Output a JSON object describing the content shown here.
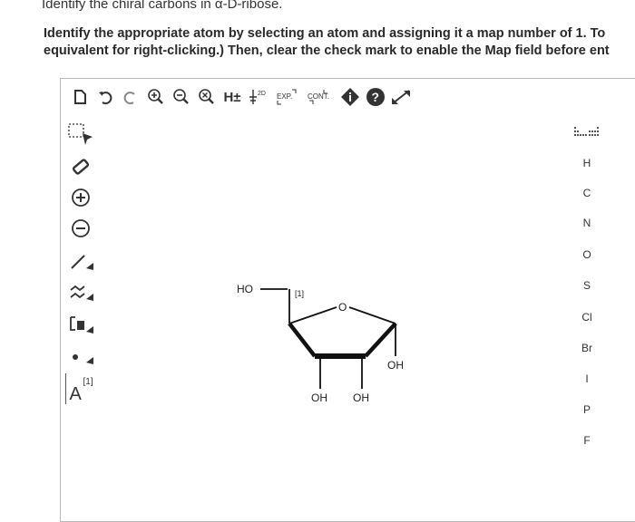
{
  "question": {
    "title": "Identify the chiral carbons in α-D-ribose.",
    "line1": "Identify the appropriate atom by selecting an atom and assigning it a map number of 1. To",
    "line2": "equivalent for right-clicking.) Then, clear the check mark to enable the Map field before ent"
  },
  "toolbar": {
    "h_plus_label": "H±",
    "exp_label": "EXP.",
    "cont_label": "CONT."
  },
  "left_tools": {
    "atom_map_label": "A",
    "atom_map_sup": "[1]"
  },
  "elements": [
    "H",
    "C",
    "N",
    "O",
    "S",
    "Cl",
    "Br",
    "I",
    "P",
    "F"
  ],
  "molecule": {
    "ho_label": "HO",
    "map_label": "[1]",
    "ring_o_label": "O",
    "oh_right_label": "OH",
    "oh_bottom_left_label": "OH",
    "oh_bottom_right_label": "OH"
  }
}
